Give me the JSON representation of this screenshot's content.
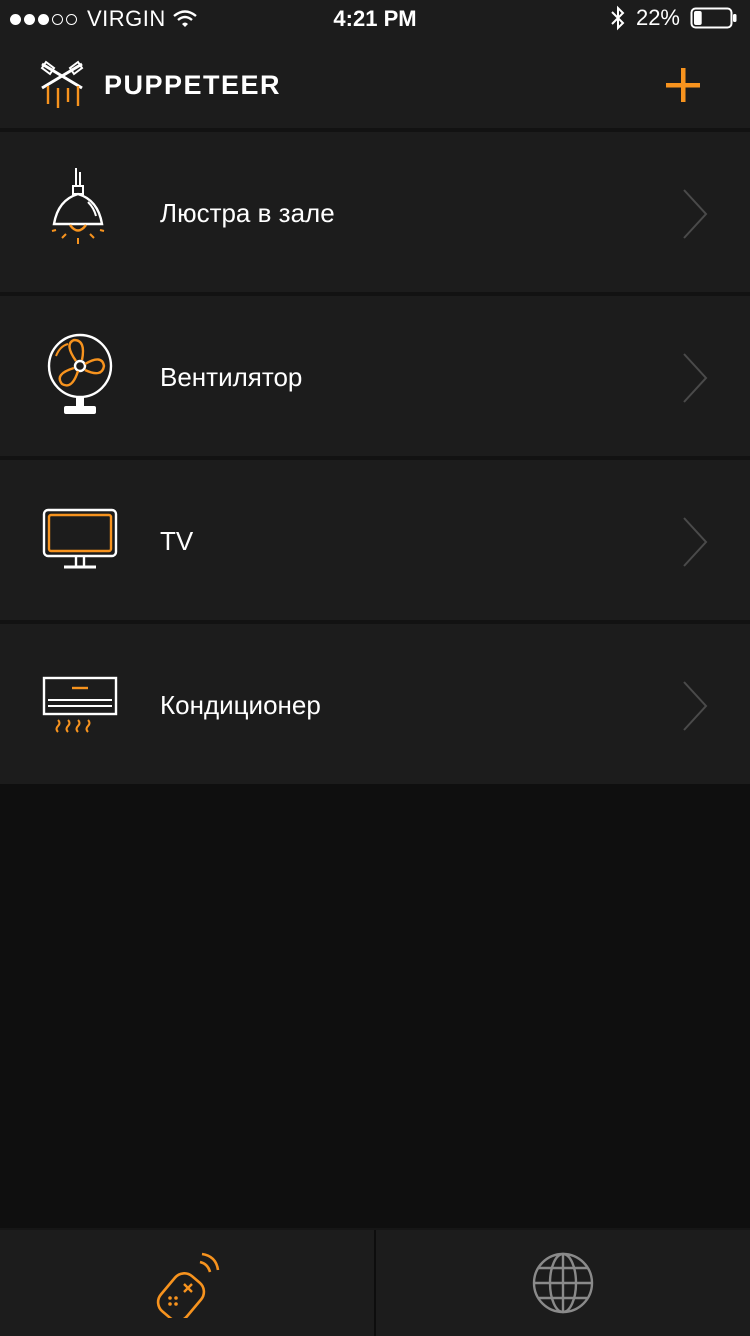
{
  "status_bar": {
    "carrier": "VIRGIN",
    "time": "4:21 PM",
    "battery": "22%",
    "signal_bars": 3,
    "signal_max": 5,
    "battery_level": 0.22
  },
  "header": {
    "title": "PUPPETEER",
    "logo_icon": "puppeteer-logo-icon",
    "add_icon": "plus-icon"
  },
  "devices": [
    {
      "label": "Люстра в зале",
      "icon": "chandelier-icon"
    },
    {
      "label": "Вентилятор",
      "icon": "fan-icon"
    },
    {
      "label": "TV",
      "icon": "tv-icon"
    },
    {
      "label": "Кондиционер",
      "icon": "air-conditioner-icon"
    }
  ],
  "tabbar": {
    "tabs": [
      {
        "icon": "remote-control-icon",
        "active": true
      },
      {
        "icon": "globe-icon",
        "active": false
      }
    ]
  },
  "colors": {
    "accent": "#f7931e",
    "background": "#0f0f0f",
    "surface": "#1c1c1c",
    "chevron": "#4a4a4a",
    "inactive_icon": "#8a8a8a"
  }
}
